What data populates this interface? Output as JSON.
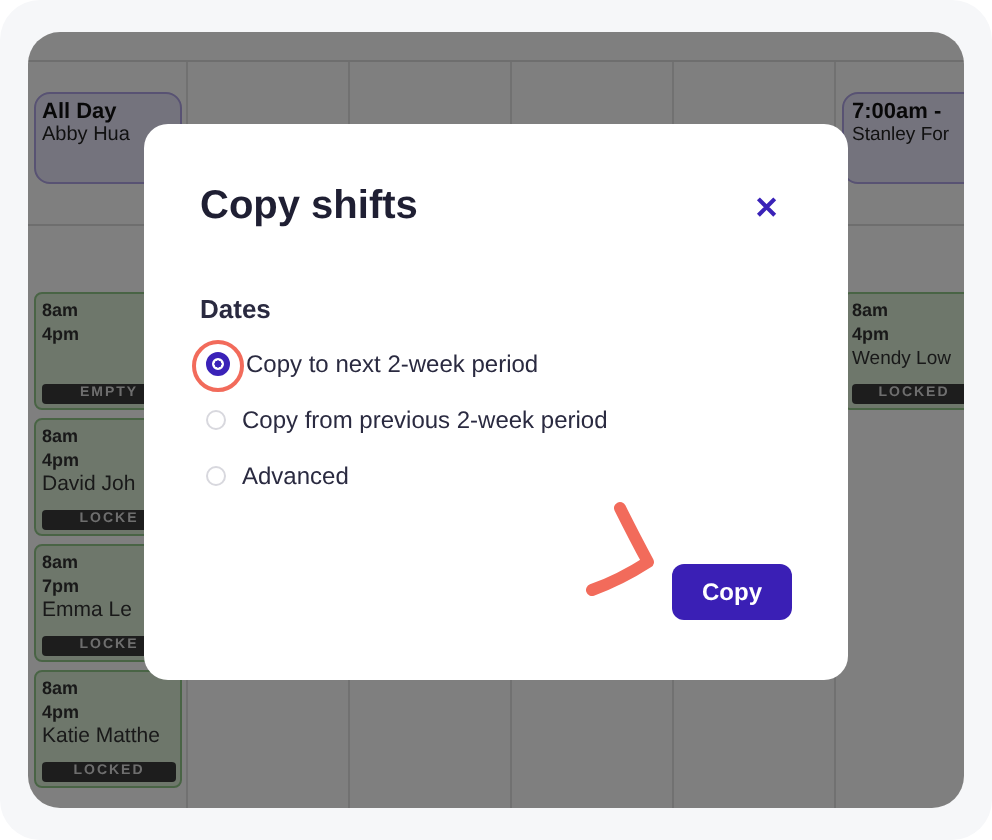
{
  "calendar": {
    "columns": [
      {
        "all_day": {
          "title": "All Day",
          "name": "Abby Hua"
        },
        "shifts": [
          {
            "start": "8am",
            "end": "4pm",
            "status": "EMPTY"
          },
          {
            "start": "8am",
            "end": "4pm",
            "name": "David Joh",
            "status": "LOCKE"
          },
          {
            "start": "8am",
            "end": "7pm",
            "name": "Emma Le",
            "status": "LOCKE"
          },
          {
            "start": "8am",
            "end": "4pm",
            "name": "Katie Matthe",
            "status": "LOCKED"
          }
        ]
      },
      {},
      {},
      {},
      {},
      {
        "all_day": {
          "title": "7:00am -",
          "name": "Stanley For"
        },
        "shifts": [
          {
            "start": "8am",
            "end": "4pm",
            "name": "Wendy Low",
            "status": "LOCKED"
          }
        ]
      }
    ]
  },
  "dialog": {
    "title": "Copy shifts",
    "close": "✕",
    "section": "Dates",
    "options": [
      {
        "label": "Copy to next 2-week period",
        "selected": true
      },
      {
        "label": "Copy from previous 2-week period",
        "selected": false
      },
      {
        "label": "Advanced",
        "selected": false
      }
    ],
    "button": "Copy"
  }
}
